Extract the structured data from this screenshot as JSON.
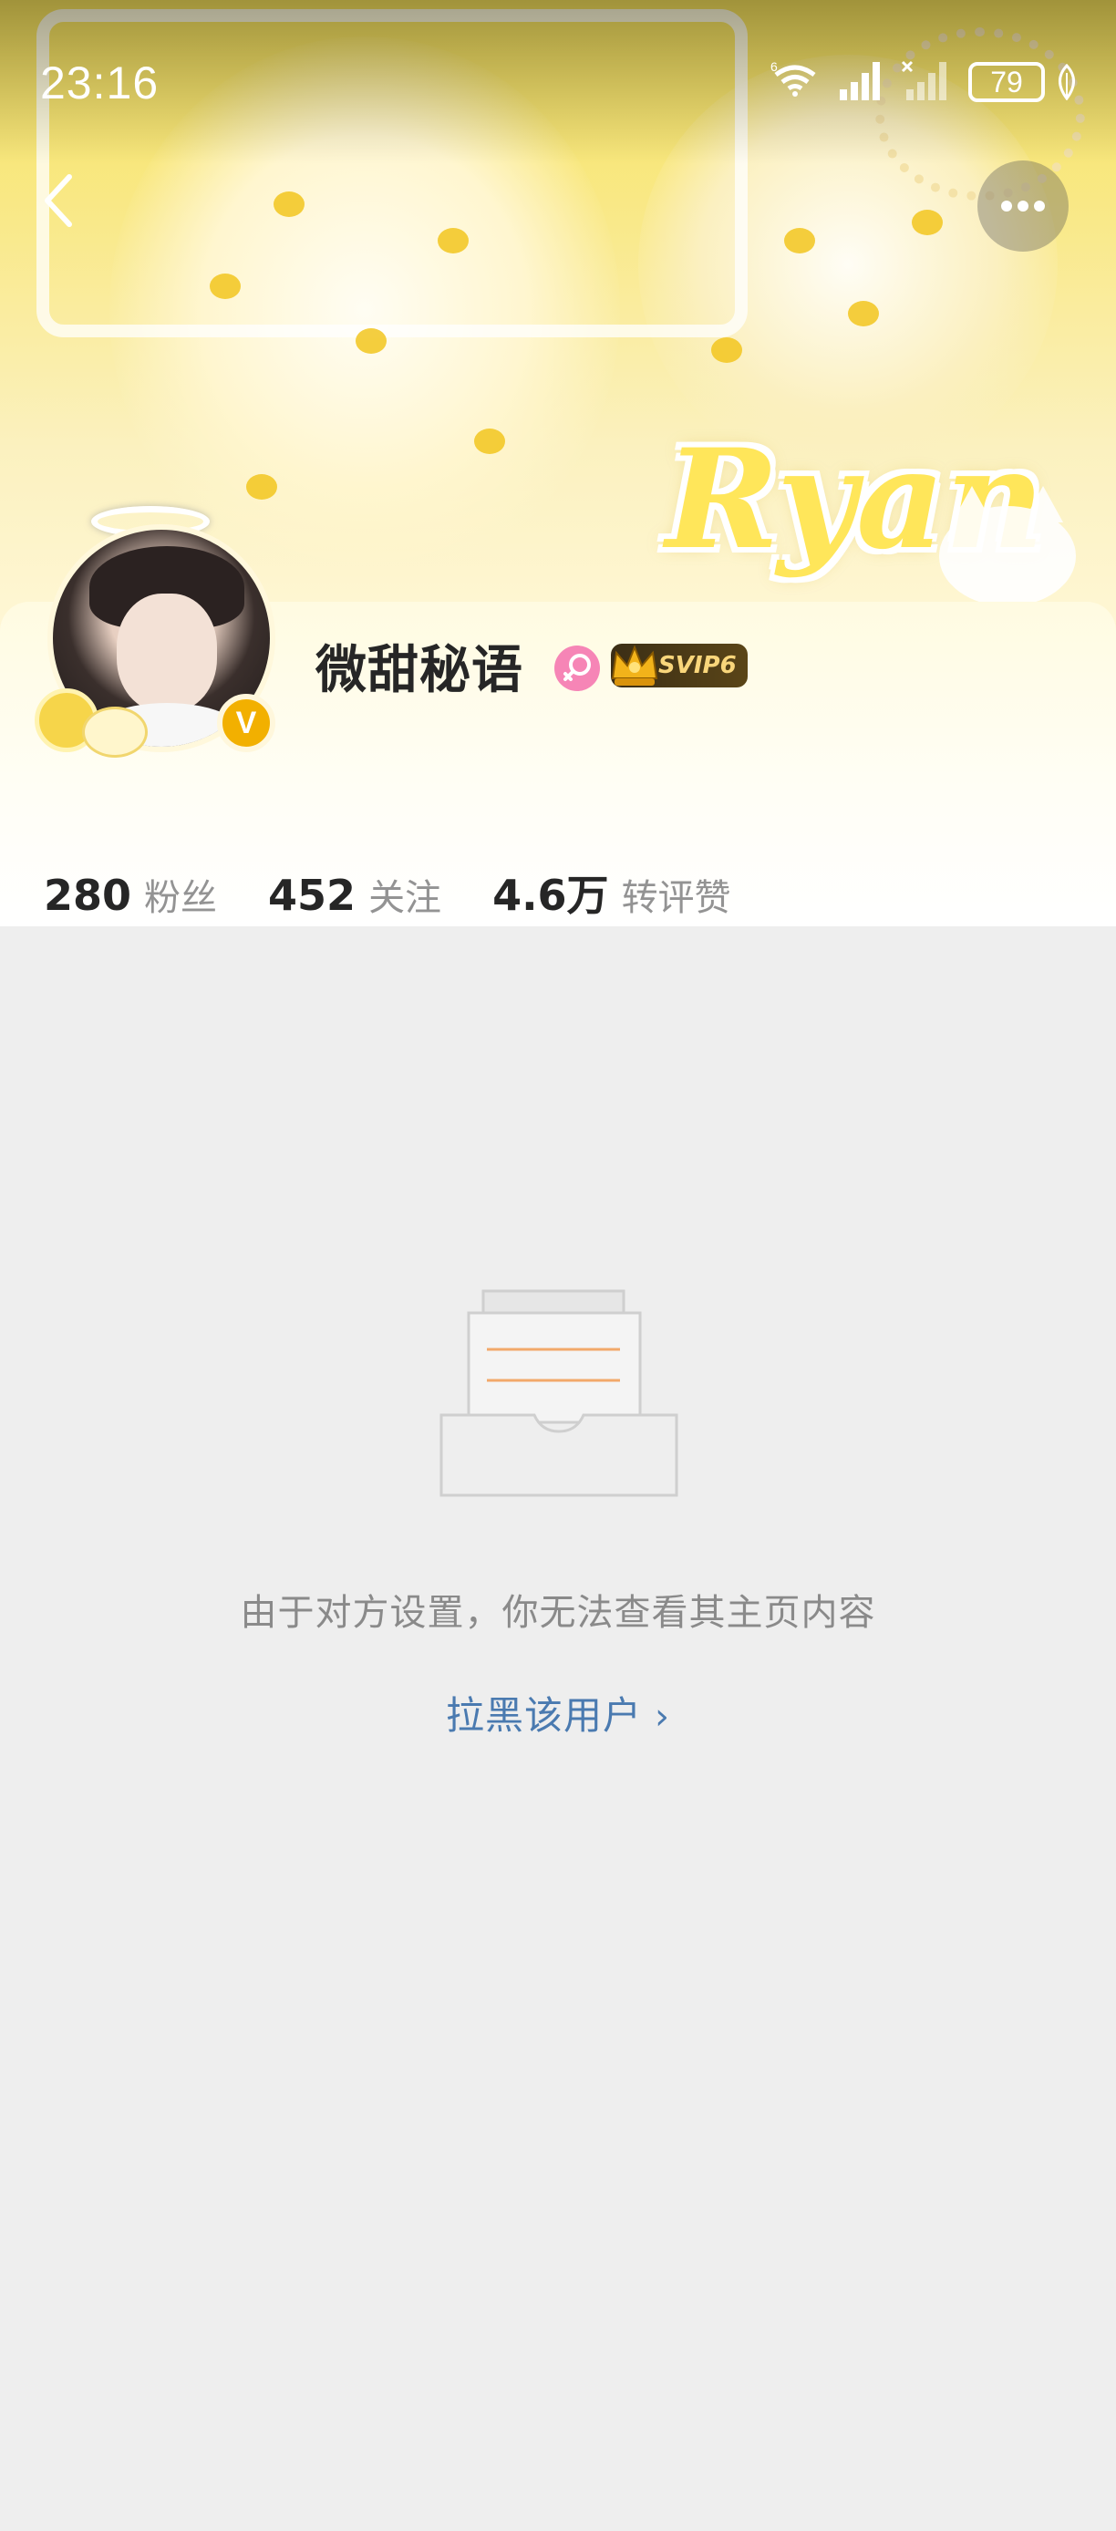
{
  "status_bar": {
    "time": "23:16",
    "battery": "79",
    "network_badge": "6",
    "icons": [
      "wifi-icon",
      "signal-strength-icon",
      "signal-no-service-icon",
      "battery-icon",
      "leaf-icon"
    ]
  },
  "nav": {
    "back_icon": "chevron-left-icon",
    "more_icon": "more-dots-icon"
  },
  "banner": {
    "script_text": "Ryan"
  },
  "profile": {
    "username": "微甜秘语",
    "gender_icon": "female-icon",
    "vip_badge": "SVIP6",
    "verified_mark": "V"
  },
  "stats": [
    {
      "value": "280",
      "label": "粉丝"
    },
    {
      "value": "452",
      "label": "关注"
    },
    {
      "value": "4.6万",
      "label": "转评赞"
    }
  ],
  "empty_state": {
    "icon": "empty-inbox-icon",
    "message": "由于对方设置，你无法查看其主页内容",
    "action_label": "拉黑该用户",
    "action_icon": "chevron-right-icon"
  },
  "colors": {
    "banner_yellow": "#f7e25a",
    "page_background": "#eeeeee",
    "link_blue": "#4a7ab0",
    "vip_gold": "#f9d67b",
    "verified_orange": "#f2b000",
    "gender_pink": "#f685b6"
  }
}
